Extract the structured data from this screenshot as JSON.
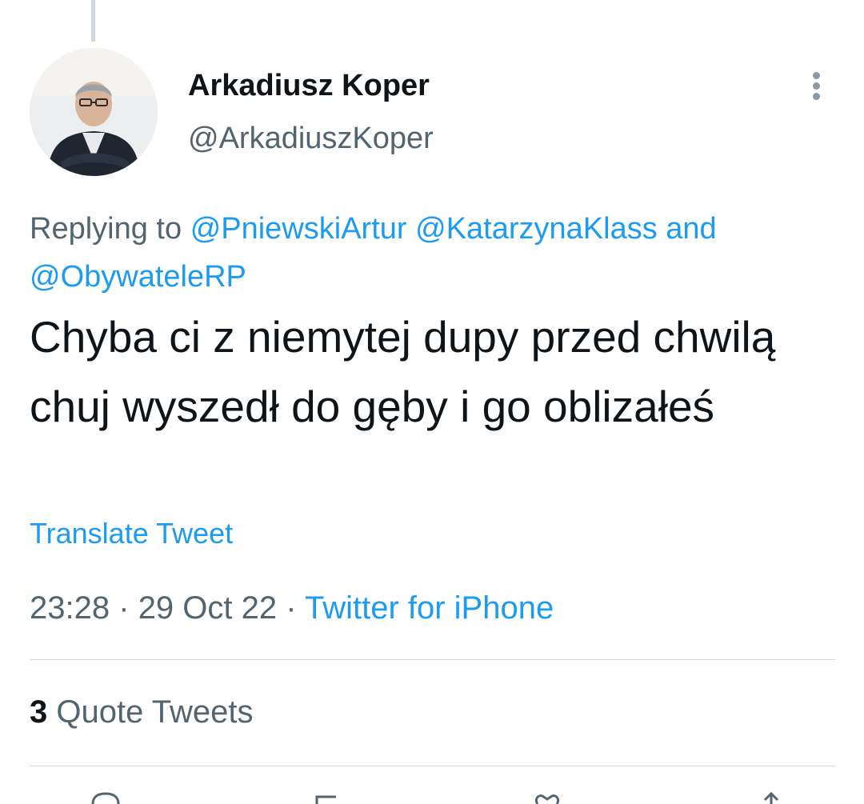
{
  "author": {
    "display_name": "Arkadiusz Koper",
    "handle": "@ArkadiuszKoper"
  },
  "reply": {
    "prefix": "Replying to",
    "mentions": [
      "@PniewskiArtur",
      "@KatarzynaKlass",
      "@ObywateleRP"
    ],
    "conjunction": "and"
  },
  "tweet": {
    "text": "Chyba ci z niemytej dupy przed chwilą chuj wyszedł do gęby i go oblizałeś",
    "translate_label": "Translate Tweet"
  },
  "meta": {
    "time": "23:28",
    "separator": "·",
    "date": "29 Oct 22",
    "source": "Twitter for iPhone"
  },
  "stats": {
    "quote_count": "3",
    "quote_label": "Quote Tweets"
  },
  "colors": {
    "link": "#1d9bf0",
    "secondary": "#536471",
    "primary": "#0f1419",
    "divider": "#cfd9de"
  },
  "icons": [
    "more-icon",
    "reply-icon",
    "retweet-icon",
    "like-icon",
    "share-icon"
  ]
}
